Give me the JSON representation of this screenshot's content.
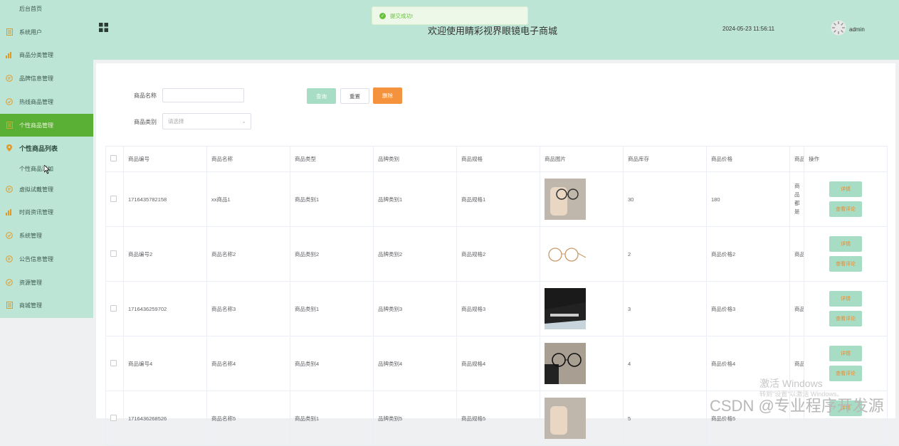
{
  "sidebar": {
    "items": [
      {
        "label": "后台首页",
        "icon": "home-icon"
      },
      {
        "label": "系统用户",
        "icon": "document-icon"
      },
      {
        "label": "商品分类管理",
        "icon": "bar-chart-icon"
      },
      {
        "label": "品牌信息管理",
        "icon": "chat-icon"
      },
      {
        "label": "热线商品管理",
        "icon": "check-circle-icon"
      },
      {
        "label": "个性商品管理",
        "icon": "document-icon"
      },
      {
        "label": "个性商品列表",
        "icon": "location-pin-icon"
      },
      {
        "label": "个性商品添加",
        "icon": ""
      },
      {
        "label": "虚拟试戴管理",
        "icon": "chat-icon"
      },
      {
        "label": "时尚资讯管理",
        "icon": "bar-chart-icon"
      },
      {
        "label": "系统管理",
        "icon": "check-circle-icon"
      },
      {
        "label": "公告信息管理",
        "icon": "chat-icon"
      },
      {
        "label": "资源管理",
        "icon": "check-circle-icon"
      },
      {
        "label": "商城管理",
        "icon": "document-icon"
      }
    ]
  },
  "header": {
    "title": "欢迎使用睛彩视界眼镜电子商城",
    "datetime": "2024-05-23 11:56:11",
    "username": "admin"
  },
  "toast": {
    "message": "提交成功!"
  },
  "search": {
    "name_label": "商品名称",
    "category_label": "商品类别",
    "category_placeholder": "请选择",
    "query_label": "查询",
    "reset_label": "重置",
    "delete_label": "删除"
  },
  "table": {
    "headers": [
      "商品编号",
      "商品名称",
      "商品类型",
      "品牌类别",
      "商品规格",
      "商品图片",
      "商品库存",
      "商品价格",
      "商品",
      "操作"
    ],
    "rows": [
      {
        "code": "1716435782158",
        "name": "xx商品1",
        "type": "商品类别1",
        "brand": "品牌类别1",
        "spec": "商品规格1",
        "image": "hand-glasses",
        "stock": "30",
        "price": "180",
        "extra": "商品\n都\n是"
      },
      {
        "code": "商品编号2",
        "name": "商品名称2",
        "type": "商品类别2",
        "brand": "品牌类别2",
        "spec": "商品规格2",
        "image": "gold-frame",
        "stock": "2",
        "price": "商品价格2",
        "extra": "商品"
      },
      {
        "code": "1716436259702",
        "name": "商品名称3",
        "type": "商品类别1",
        "brand": "品牌类别3",
        "spec": "商品规格3",
        "image": "dark-case",
        "stock": "3",
        "price": "商品价格3",
        "extra": "商品"
      },
      {
        "code": "商品编号4",
        "name": "商品名称4",
        "type": "商品类别4",
        "brand": "品牌类别4",
        "spec": "商品规格4",
        "image": "black-frame",
        "stock": "4",
        "price": "商品价格4",
        "extra": "商品"
      },
      {
        "code": "1716436268526",
        "name": "商品名称5",
        "type": "商品类别1",
        "brand": "品牌类别5",
        "spec": "商品规格5",
        "image": "hand-glasses",
        "stock": "5",
        "price": "商品价格5",
        "extra": ""
      }
    ],
    "detail_label": "详情",
    "review_label": "查看评论"
  },
  "watermark": {
    "activate_title": "激活 Windows",
    "activate_sub": "转到\"设置\"以激活 Windows。",
    "csdn": "CSDN @专业程序开发源"
  }
}
